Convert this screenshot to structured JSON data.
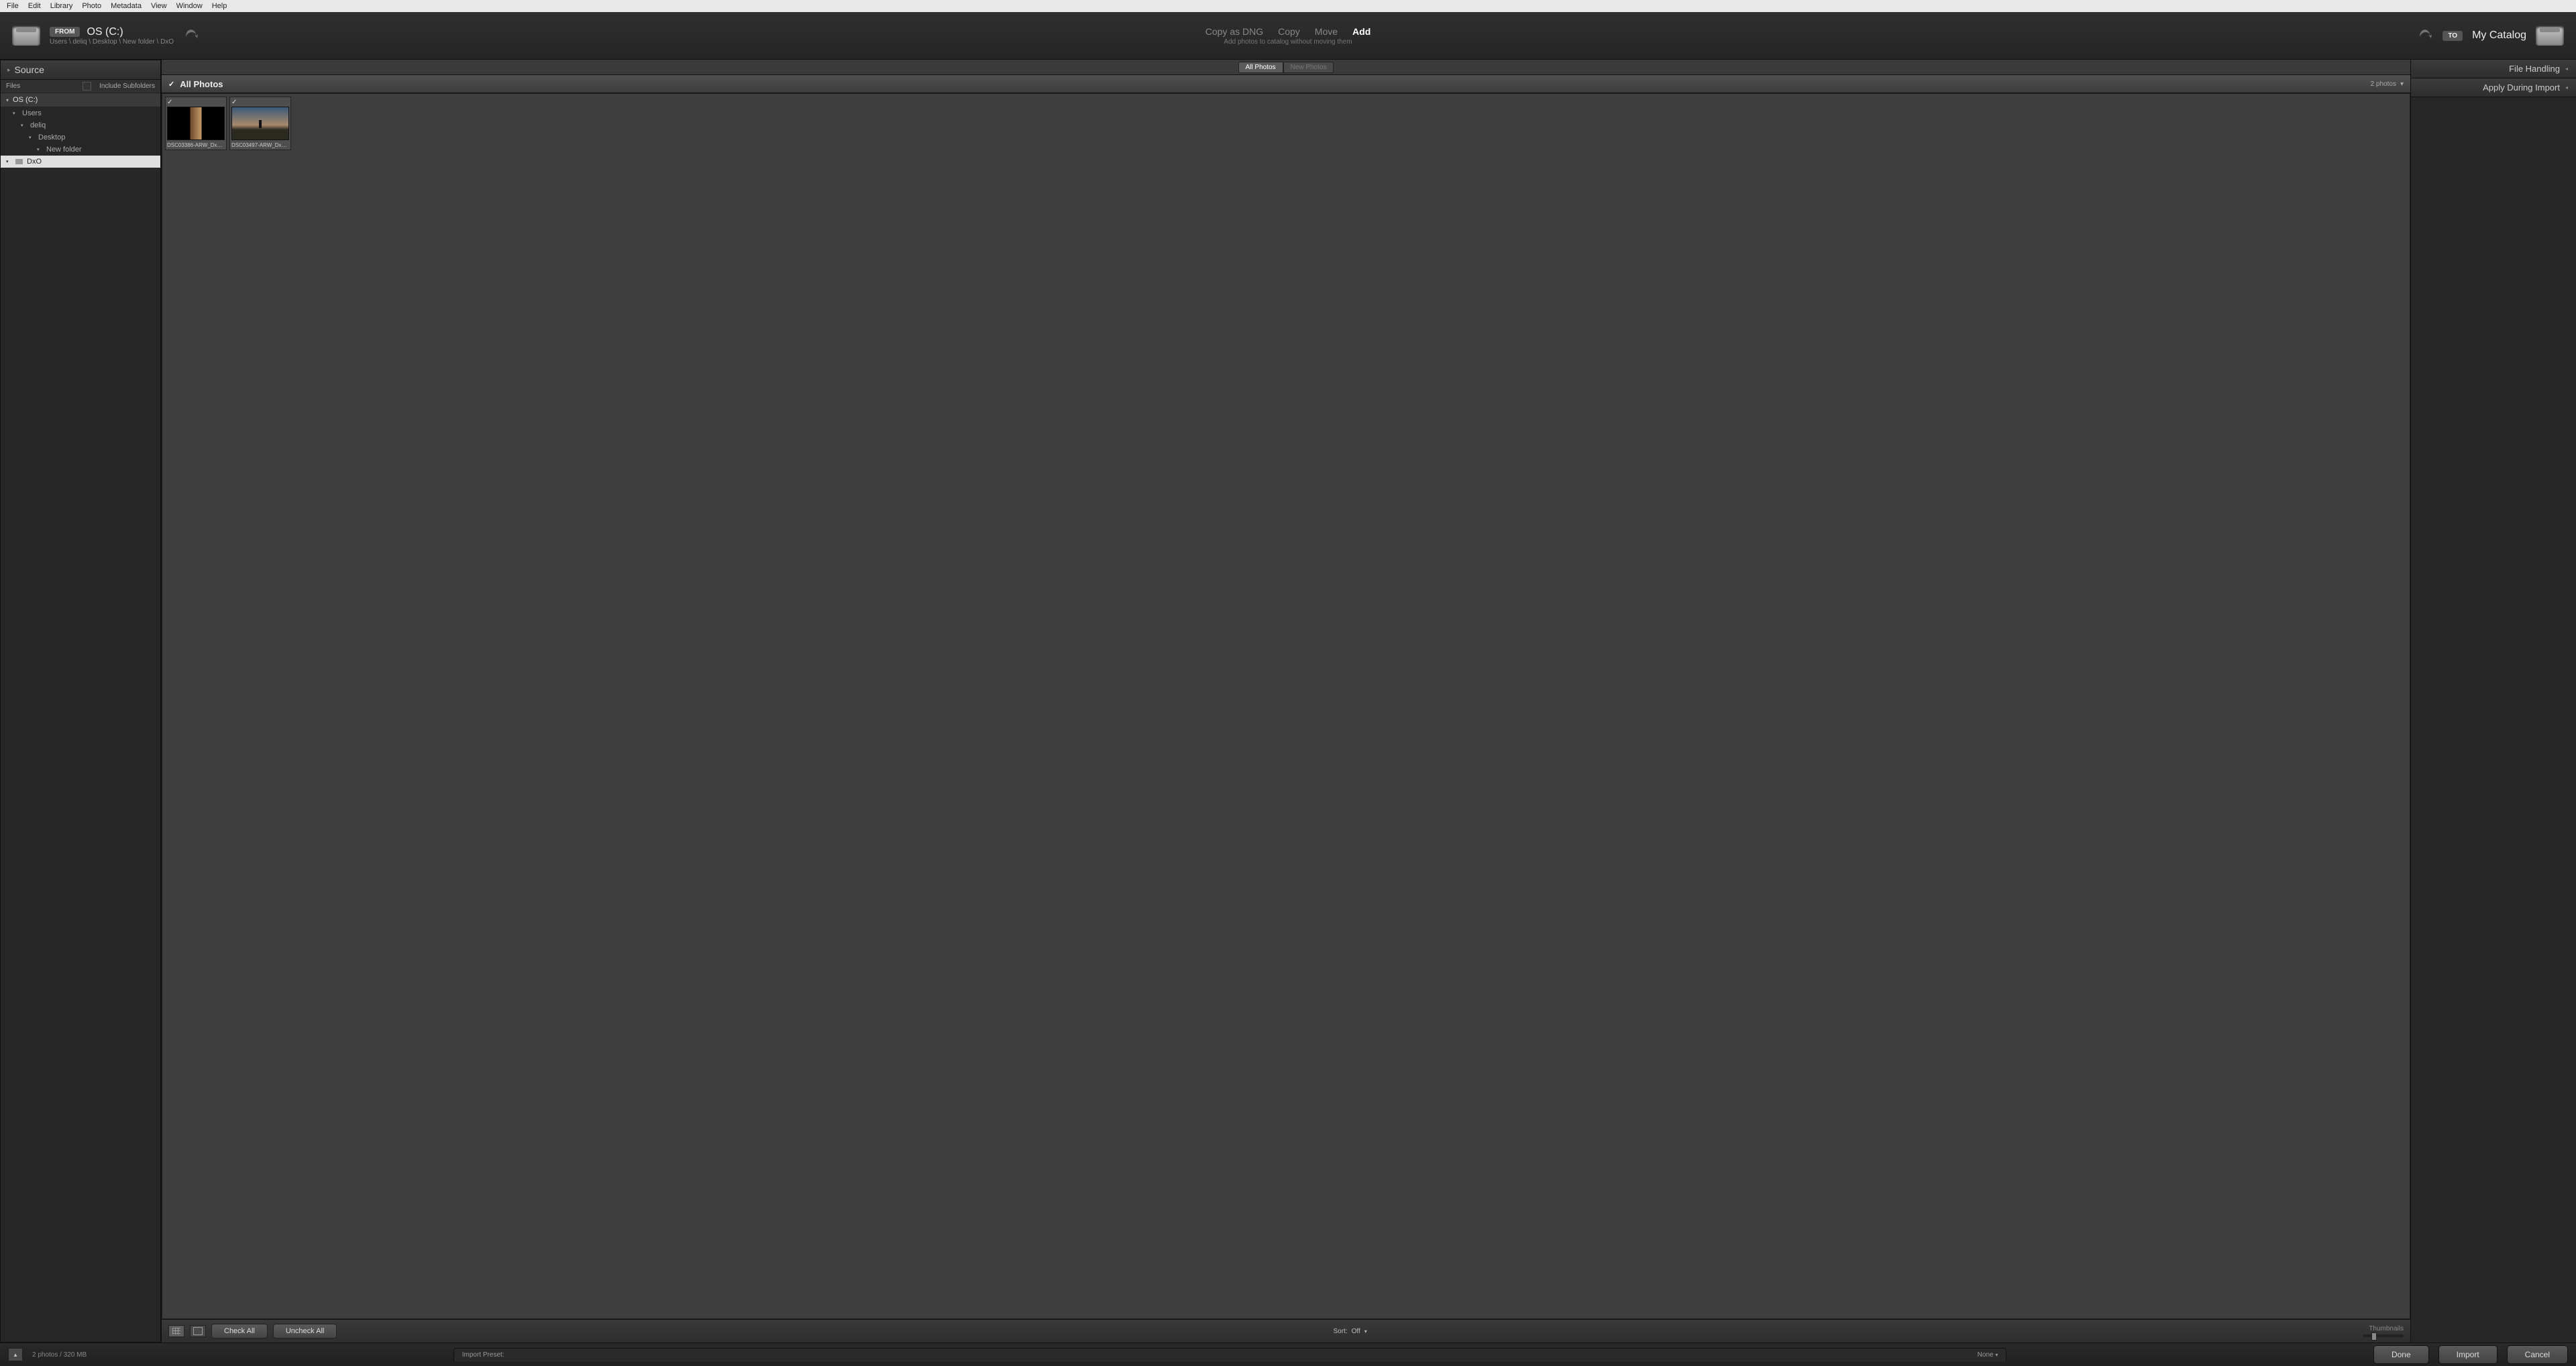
{
  "menu": {
    "file": "File",
    "edit": "Edit",
    "library": "Library",
    "photo": "Photo",
    "metadata": "Metadata",
    "view": "View",
    "window": "Window",
    "help": "Help"
  },
  "top": {
    "from_badge": "FROM",
    "source_label": "OS (C:)",
    "breadcrumb": "Users \\ deliq \\ Desktop \\ New folder \\ DxO",
    "modes": {
      "copy_dng": "Copy as DNG",
      "copy": "Copy",
      "move": "Move",
      "add": "Add"
    },
    "modes_active": "Add",
    "subtitle": "Add photos to catalog without moving them",
    "to_badge": "TO",
    "to_label": "My Catalog"
  },
  "segbar": {
    "all": "All Photos",
    "new": "New Photos"
  },
  "left": {
    "panel_title": "Source",
    "files_label": "Files",
    "include_sub": "Include Subfolders",
    "drive": "OS (C:)",
    "tree": [
      {
        "label": "Users",
        "indent": 1
      },
      {
        "label": "deliq",
        "indent": 2
      },
      {
        "label": "Desktop",
        "indent": 3
      },
      {
        "label": "New folder",
        "indent": 4
      },
      {
        "label": "DxO",
        "indent": 5,
        "selected": true
      }
    ]
  },
  "center": {
    "header": "All Photos",
    "count": "2 photos",
    "thumbs": [
      {
        "name": "DSC03386-ARW_DxO_...",
        "scene": "scene1"
      },
      {
        "name": "DSC03497-ARW_DxO_...",
        "scene": "scene2"
      }
    ],
    "check_all": "Check All",
    "uncheck_all": "Uncheck All",
    "sort_label": "Sort:",
    "sort_value": "Off",
    "thumbs_label": "Thumbnails",
    "preset_label": "Import Preset:",
    "preset_value": "None"
  },
  "right": {
    "file_handling": "File Handling",
    "apply_during": "Apply During Import"
  },
  "bottom": {
    "status": "2 photos / 320 MB",
    "done": "Done",
    "import": "Import",
    "cancel": "Cancel"
  }
}
